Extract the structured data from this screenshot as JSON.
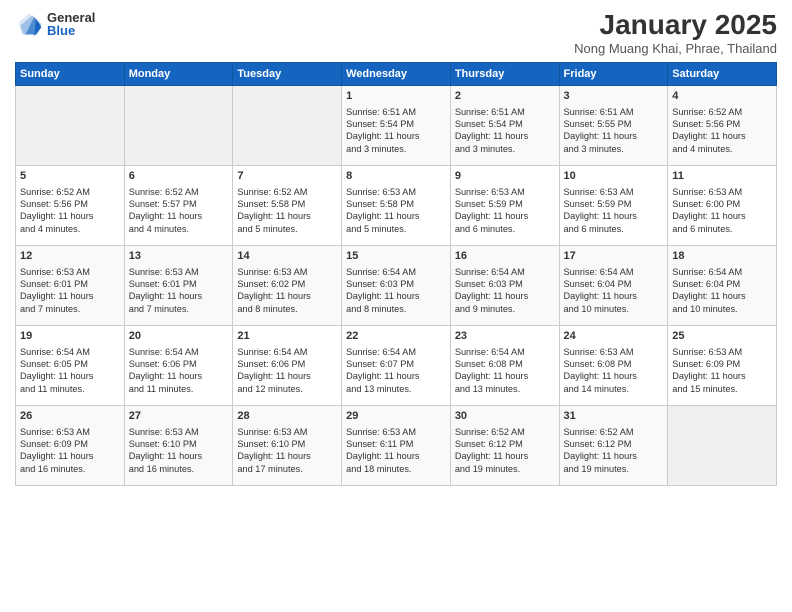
{
  "header": {
    "logo_general": "General",
    "logo_blue": "Blue",
    "title": "January 2025",
    "subtitle": "Nong Muang Khai, Phrae, Thailand"
  },
  "weekdays": [
    "Sunday",
    "Monday",
    "Tuesday",
    "Wednesday",
    "Thursday",
    "Friday",
    "Saturday"
  ],
  "weeks": [
    [
      {
        "day": "",
        "content": ""
      },
      {
        "day": "",
        "content": ""
      },
      {
        "day": "",
        "content": ""
      },
      {
        "day": "1",
        "content": "Sunrise: 6:51 AM\nSunset: 5:54 PM\nDaylight: 11 hours\nand 3 minutes."
      },
      {
        "day": "2",
        "content": "Sunrise: 6:51 AM\nSunset: 5:54 PM\nDaylight: 11 hours\nand 3 minutes."
      },
      {
        "day": "3",
        "content": "Sunrise: 6:51 AM\nSunset: 5:55 PM\nDaylight: 11 hours\nand 3 minutes."
      },
      {
        "day": "4",
        "content": "Sunrise: 6:52 AM\nSunset: 5:56 PM\nDaylight: 11 hours\nand 4 minutes."
      }
    ],
    [
      {
        "day": "5",
        "content": "Sunrise: 6:52 AM\nSunset: 5:56 PM\nDaylight: 11 hours\nand 4 minutes."
      },
      {
        "day": "6",
        "content": "Sunrise: 6:52 AM\nSunset: 5:57 PM\nDaylight: 11 hours\nand 4 minutes."
      },
      {
        "day": "7",
        "content": "Sunrise: 6:52 AM\nSunset: 5:58 PM\nDaylight: 11 hours\nand 5 minutes."
      },
      {
        "day": "8",
        "content": "Sunrise: 6:53 AM\nSunset: 5:58 PM\nDaylight: 11 hours\nand 5 minutes."
      },
      {
        "day": "9",
        "content": "Sunrise: 6:53 AM\nSunset: 5:59 PM\nDaylight: 11 hours\nand 6 minutes."
      },
      {
        "day": "10",
        "content": "Sunrise: 6:53 AM\nSunset: 5:59 PM\nDaylight: 11 hours\nand 6 minutes."
      },
      {
        "day": "11",
        "content": "Sunrise: 6:53 AM\nSunset: 6:00 PM\nDaylight: 11 hours\nand 6 minutes."
      }
    ],
    [
      {
        "day": "12",
        "content": "Sunrise: 6:53 AM\nSunset: 6:01 PM\nDaylight: 11 hours\nand 7 minutes."
      },
      {
        "day": "13",
        "content": "Sunrise: 6:53 AM\nSunset: 6:01 PM\nDaylight: 11 hours\nand 7 minutes."
      },
      {
        "day": "14",
        "content": "Sunrise: 6:53 AM\nSunset: 6:02 PM\nDaylight: 11 hours\nand 8 minutes."
      },
      {
        "day": "15",
        "content": "Sunrise: 6:54 AM\nSunset: 6:03 PM\nDaylight: 11 hours\nand 8 minutes."
      },
      {
        "day": "16",
        "content": "Sunrise: 6:54 AM\nSunset: 6:03 PM\nDaylight: 11 hours\nand 9 minutes."
      },
      {
        "day": "17",
        "content": "Sunrise: 6:54 AM\nSunset: 6:04 PM\nDaylight: 11 hours\nand 10 minutes."
      },
      {
        "day": "18",
        "content": "Sunrise: 6:54 AM\nSunset: 6:04 PM\nDaylight: 11 hours\nand 10 minutes."
      }
    ],
    [
      {
        "day": "19",
        "content": "Sunrise: 6:54 AM\nSunset: 6:05 PM\nDaylight: 11 hours\nand 11 minutes."
      },
      {
        "day": "20",
        "content": "Sunrise: 6:54 AM\nSunset: 6:06 PM\nDaylight: 11 hours\nand 11 minutes."
      },
      {
        "day": "21",
        "content": "Sunrise: 6:54 AM\nSunset: 6:06 PM\nDaylight: 11 hours\nand 12 minutes."
      },
      {
        "day": "22",
        "content": "Sunrise: 6:54 AM\nSunset: 6:07 PM\nDaylight: 11 hours\nand 13 minutes."
      },
      {
        "day": "23",
        "content": "Sunrise: 6:54 AM\nSunset: 6:08 PM\nDaylight: 11 hours\nand 13 minutes."
      },
      {
        "day": "24",
        "content": "Sunrise: 6:53 AM\nSunset: 6:08 PM\nDaylight: 11 hours\nand 14 minutes."
      },
      {
        "day": "25",
        "content": "Sunrise: 6:53 AM\nSunset: 6:09 PM\nDaylight: 11 hours\nand 15 minutes."
      }
    ],
    [
      {
        "day": "26",
        "content": "Sunrise: 6:53 AM\nSunset: 6:09 PM\nDaylight: 11 hours\nand 16 minutes."
      },
      {
        "day": "27",
        "content": "Sunrise: 6:53 AM\nSunset: 6:10 PM\nDaylight: 11 hours\nand 16 minutes."
      },
      {
        "day": "28",
        "content": "Sunrise: 6:53 AM\nSunset: 6:10 PM\nDaylight: 11 hours\nand 17 minutes."
      },
      {
        "day": "29",
        "content": "Sunrise: 6:53 AM\nSunset: 6:11 PM\nDaylight: 11 hours\nand 18 minutes."
      },
      {
        "day": "30",
        "content": "Sunrise: 6:52 AM\nSunset: 6:12 PM\nDaylight: 11 hours\nand 19 minutes."
      },
      {
        "day": "31",
        "content": "Sunrise: 6:52 AM\nSunset: 6:12 PM\nDaylight: 11 hours\nand 19 minutes."
      },
      {
        "day": "",
        "content": ""
      }
    ]
  ]
}
